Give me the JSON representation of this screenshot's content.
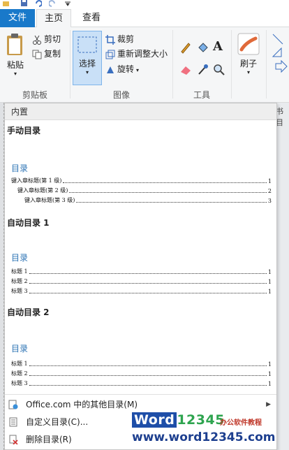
{
  "tabs": {
    "file": "文件",
    "home": "主页",
    "view": "查看"
  },
  "ribbon": {
    "clipboard": {
      "paste": "粘贴",
      "cut": "剪切",
      "copy": "复制",
      "label": "剪贴板"
    },
    "image": {
      "select": "选择",
      "crop": "裁剪",
      "resize": "重新调整大小",
      "rotate": "旋转",
      "label": "图像"
    },
    "tools": {
      "label": "工具",
      "text_glyph": "A"
    },
    "brushes": {
      "label": "刷子"
    }
  },
  "doc_peek": "书目",
  "gallery": {
    "header": "内置",
    "entries": [
      {
        "title": "手动目录",
        "toc_heading": "目录",
        "lines": [
          {
            "text": "键入章标题(第 1 级)",
            "page": "1"
          },
          {
            "text": "键入章标题(第 2 级)",
            "page": "2"
          },
          {
            "text": "键入章标题(第 3 级)",
            "page": "3"
          }
        ]
      },
      {
        "title": "自动目录 1",
        "toc_heading": "目录",
        "lines": [
          {
            "text": "标题 1",
            "page": "1"
          },
          {
            "text": "标题 2",
            "page": "1"
          },
          {
            "text": "标题 3",
            "page": "1"
          }
        ]
      },
      {
        "title": "自动目录 2",
        "toc_heading": "目录",
        "lines": [
          {
            "text": "标题 1",
            "page": "1"
          },
          {
            "text": "标题 2",
            "page": "1"
          },
          {
            "text": "标题 3",
            "page": "1"
          }
        ]
      }
    ],
    "menu": {
      "more": "Office.com 中的其他目录(M)",
      "custom": "自定义目录(C)...",
      "remove": "删除目录(R)"
    }
  },
  "watermark": {
    "brand_word": "Word",
    "brand_num": "12345",
    "tagline": "办公软件教程",
    "url": "www.word12345.com"
  },
  "colors": {
    "file_tab": "#1979ca",
    "toc_heading": "#2e74b5",
    "select_bg": "#c9e0f7"
  }
}
